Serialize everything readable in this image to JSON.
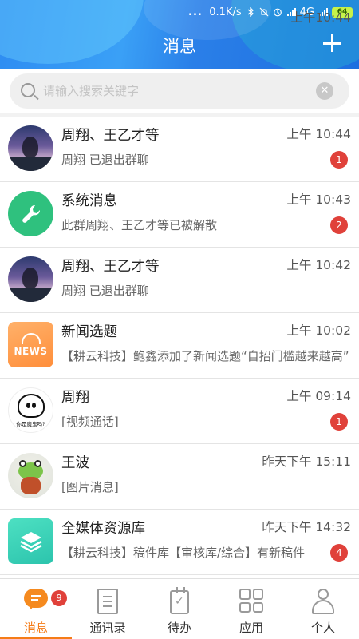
{
  "statusbar": {
    "time": "上午10:44",
    "dots": "...",
    "speed": "0.1K/s",
    "network": "4G",
    "battery": "64"
  },
  "header": {
    "title": "消息"
  },
  "search": {
    "placeholder": "请输入搜索关键字"
  },
  "conversations": [
    {
      "name": "周翔、王乙才等",
      "time": "上午 10:44",
      "preview": "周翔 已退出群聊",
      "unread": "1"
    },
    {
      "name": "系统消息",
      "time": "上午 10:43",
      "preview": "此群周翔、王乙才等已被解散",
      "unread": "2"
    },
    {
      "name": "周翔、王乙才等",
      "time": "上午 10:42",
      "preview": "周翔 已退出群聊",
      "unread": ""
    },
    {
      "name": "新闻选题",
      "time": "上午 10:02",
      "preview": "【耕云科技】鲍鑫添加了新闻选题“自招门槛越来越高”",
      "unread": "",
      "avatar_text": "NEWS"
    },
    {
      "name": "周翔",
      "time": "上午 09:14",
      "preview": "[视频通话]",
      "unread": "1",
      "avatar_text": "你是魔鬼吗?"
    },
    {
      "name": "王波",
      "time": "昨天下午 15:11",
      "preview": "[图片消息]",
      "unread": ""
    },
    {
      "name": "全媒体资源库",
      "time": "昨天下午 14:32",
      "preview": "【耕云科技】稿件库【审核库/综合】有新稿件",
      "unread": "4"
    }
  ],
  "tabbar": {
    "tabs": [
      {
        "label": "消息",
        "badge": "9"
      },
      {
        "label": "通讯录"
      },
      {
        "label": "待办"
      },
      {
        "label": "应用"
      },
      {
        "label": "个人"
      }
    ]
  },
  "colors": {
    "header_blue": "#2e8cf2",
    "accent_orange": "#f57c17",
    "badge_red": "#e0413a"
  }
}
